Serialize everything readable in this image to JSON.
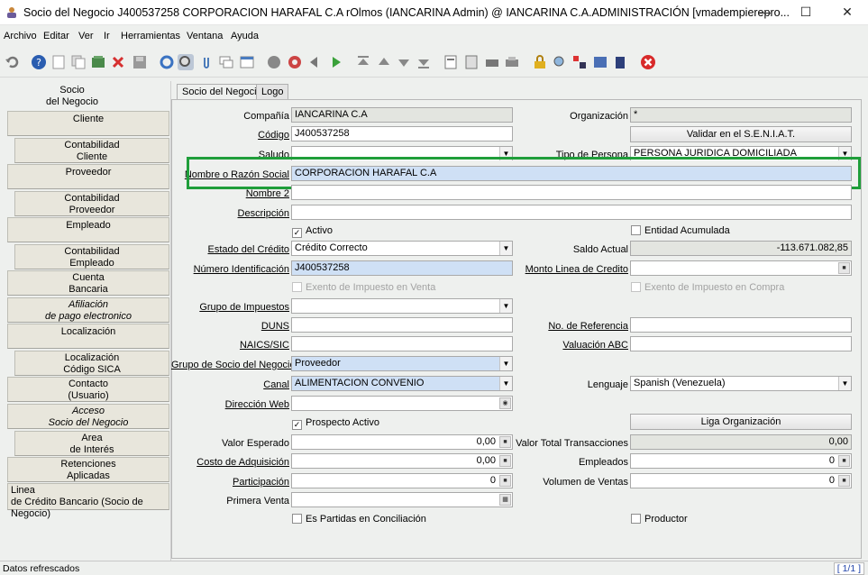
{
  "window": {
    "title": "Socio del Negocio  J400537258  CORPORACION HARAFAL C.A  rOlmos (IANCARINA Admin) @ IANCARINA C.A.ADMINISTRACIÓN [vmadempierepro...",
    "minimize": "—",
    "maximize": "☐",
    "close": "✕"
  },
  "menu": [
    "Archivo",
    "Editar",
    "Ver",
    "Ir",
    "Herramientas",
    "Ventana",
    "Ayuda"
  ],
  "left_tabs": [
    {
      "label": "Socio\ndel Negocio"
    },
    {
      "label": "Cliente"
    },
    {
      "label": "Contabilidad\nCliente"
    },
    {
      "label": "Proveedor"
    },
    {
      "label": "Contabilidad\nProveedor"
    },
    {
      "label": "Empleado"
    },
    {
      "label": "Contabilidad\nEmpleado"
    },
    {
      "label": "Cuenta\nBancaria"
    },
    {
      "label": "Afiliación\nde pago electronico"
    },
    {
      "label": "Localización"
    },
    {
      "label": "Localización\nCódigo SICA"
    },
    {
      "label": "Contacto\n(Usuario)"
    },
    {
      "label": "Acceso\nSocio del Negocio"
    },
    {
      "label": "Area\nde Interés"
    },
    {
      "label": "Retenciones\nAplicadas"
    },
    {
      "label": "Linea\nde Crédito Bancario (Socio de Negocio)"
    }
  ],
  "tabs": [
    "Socio del Negocio",
    "Logo"
  ],
  "form": {
    "compania_label": "Compañía",
    "compania_value": "IANCARINA C.A",
    "organizacion_label": "Organización",
    "organizacion_value": "*",
    "codigo_label": "Código",
    "codigo_value": "J400537258",
    "validar_button": "Validar en el S.E.N.I.A.T.",
    "saludo_label": "Saludo",
    "tipo_persona_label": "Tipo de Persona",
    "tipo_persona_value": "PERSONA JURIDICA DOMICILIADA",
    "nombre_label": "Nombre o Razón Social",
    "nombre_value": "CORPORACION HARAFAL C.A",
    "nombre2_label": "Nombre 2",
    "descripcion_label": "Descripción",
    "activo_label": "Activo",
    "entidad_acumulada_label": "Entidad Acumulada",
    "estado_credito_label": "Estado del Crédito",
    "estado_credito_value": "Crédito Correcto",
    "saldo_actual_label": "Saldo Actual",
    "saldo_actual_value": "-113.671.082,85",
    "numero_id_label": "Número Identificación",
    "numero_id_value": "J400537258",
    "monto_linea_label": "Monto Linea de Credito",
    "exento_venta_label": "Exento de Impuesto en Venta",
    "exento_compra_label": "Exento de Impuesto en Compra",
    "grupo_impuestos_label": "Grupo de Impuestos",
    "duns_label": "DUNS",
    "no_referencia_label": "No. de Referencia",
    "naics_label": "NAICS/SIC",
    "valuacion_label": "Valuación ABC",
    "grupo_socio_label": "Grupo de Socio del Negocio",
    "grupo_socio_value": "Proveedor",
    "canal_label": "Canal",
    "canal_value": "ALIMENTACION CONVENIO",
    "lenguaje_label": "Lenguaje",
    "lenguaje_value": "Spanish (Venezuela)",
    "direccion_web_label": "Dirección Web",
    "prospecto_label": "Prospecto Activo",
    "liga_button": "Liga Organización",
    "valor_esperado_label": "Valor Esperado",
    "valor_esperado_value": "0,00",
    "valor_total_label": "Valor Total Transacciones",
    "valor_total_value": "0,00",
    "costo_adq_label": "Costo de Adquisición",
    "costo_adq_value": "0,00",
    "empleados_label": "Empleados",
    "empleados_value": "0",
    "participacion_label": "Participación",
    "participacion_value": "0",
    "volumen_label": "Volumen de Ventas",
    "volumen_value": "0",
    "primera_venta_label": "Primera Venta",
    "partidas_label": "Es Partidas en Conciliación",
    "productor_label": "Productor"
  },
  "status": {
    "message": "Datos refrescados",
    "pages": "[ 1/1 ]"
  },
  "icons": [
    "undo-icon",
    "help-icon",
    "new-icon",
    "copy-icon",
    "delete-selection-icon",
    "delete-icon",
    "save-icon",
    "refresh-icon",
    "find-icon",
    "attachment-icon",
    "chat-icon",
    "grid-toggle-icon",
    "history-icon",
    "home-icon",
    "parent-icon",
    "detail-icon",
    "first-icon",
    "previous-icon",
    "next-icon",
    "last-icon",
    "report-icon",
    "archive-icon",
    "print-preview-icon",
    "print-icon",
    "lock-icon",
    "zoom-across-icon",
    "request-icon",
    "product-info-icon",
    "exit-icon"
  ],
  "colors": {
    "highlight": "#1f9e3a",
    "field_blue": "#cfe0f5",
    "readonly": "#e3e5e0"
  }
}
